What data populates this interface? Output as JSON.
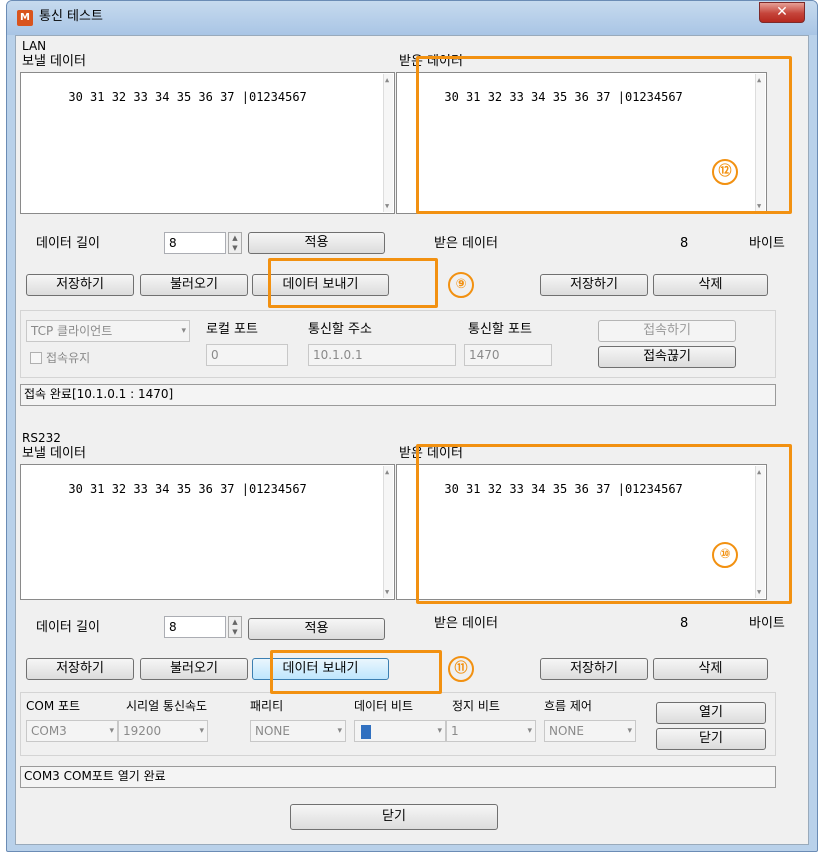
{
  "window": {
    "title": "통신 테스트",
    "icon_letter": "M",
    "close_glyph": "✕"
  },
  "lan": {
    "group_label": "LAN",
    "send_label": "보낼 데이터",
    "send_text": "30 31 32 33 34 35 36 37 |01234567",
    "recv_label": "받은 데이터",
    "recv_text": "30 31 32 33 34 35 36 37 |01234567",
    "data_length_label": "데이터 길이",
    "data_length_value": "8",
    "apply_button": "적용",
    "recv_data_label": "받은 데이터",
    "recv_count": "8",
    "bytes_label": "바이트",
    "save_button": "저장하기",
    "load_button": "불러오기",
    "send_button": "데이터 보내기",
    "recv_save_button": "저장하기",
    "delete_button": "삭제",
    "mode_value": "TCP 클라이언트",
    "keep_alive_label": "접속유지",
    "local_port_label": "로컬 포트",
    "local_port_value": "0",
    "remote_addr_label": "통신할 주소",
    "remote_addr_value": "10.1.0.1",
    "remote_port_label": "통신할 포트",
    "remote_port_value": "1470",
    "connect_button": "접속하기",
    "disconnect_button": "접속끊기",
    "status": "접속 완료[10.1.0.1 : 1470]"
  },
  "rs232": {
    "group_label": "RS232",
    "send_label": "보낼 데이터",
    "send_text": "30 31 32 33 34 35 36 37 |01234567",
    "recv_label": "받은 데이터",
    "recv_text": "30 31 32 33 34 35 36 37 |01234567",
    "data_length_label": "데이터 길이",
    "data_length_value": "8",
    "apply_button": "적용",
    "recv_data_label": "받은 데이터",
    "recv_count": "8",
    "bytes_label": "바이트",
    "save_button": "저장하기",
    "load_button": "불러오기",
    "send_button": "데이터 보내기",
    "recv_save_button": "저장하기",
    "delete_button": "삭제",
    "com_port_label": "COM 포트",
    "com_port_value": "COM3",
    "baud_label": "시리얼 통신속도",
    "baud_value": "19200",
    "parity_label": "패리티",
    "parity_value": "NONE",
    "data_bits_label": "데이터 비트",
    "data_bits_value": "",
    "stop_bits_label": "정지 비트",
    "stop_bits_value": "1",
    "flow_label": "흐름 제어",
    "flow_value": "NONE",
    "open_button": "열기",
    "close_port_button": "닫기",
    "status": "COM3 COM포트 열기 완료"
  },
  "footer": {
    "close_button": "닫기"
  },
  "annotations": {
    "badge_9": "⑨",
    "badge_10": "⑩",
    "badge_11": "⑪",
    "badge_12": "⑫",
    "color": "#f29111"
  }
}
